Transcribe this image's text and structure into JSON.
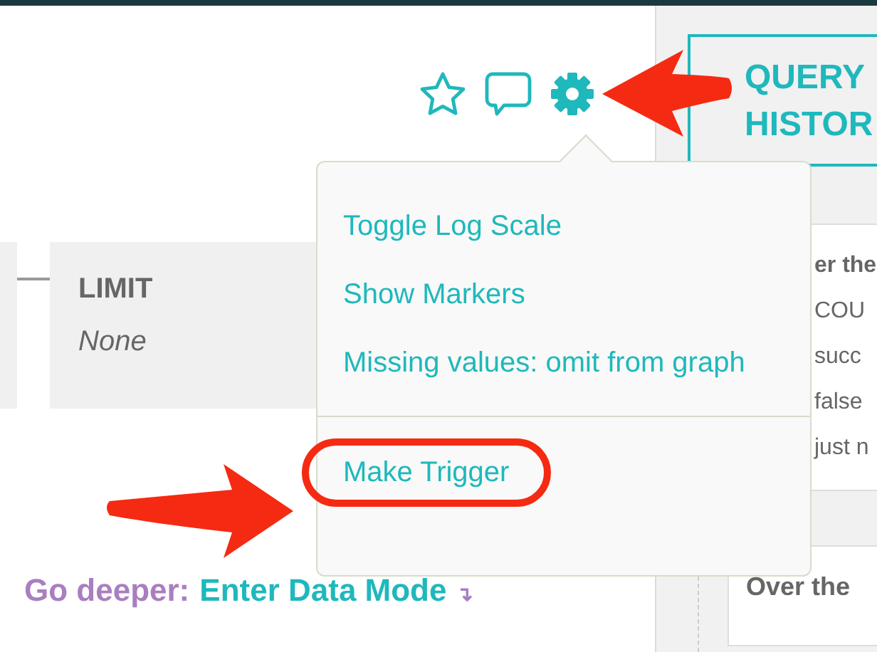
{
  "limit": {
    "label": "LIMIT",
    "value": "None"
  },
  "menu": {
    "sections": [
      [
        {
          "label": "Toggle Log Scale",
          "highlighted": false
        },
        {
          "label": "Show Markers",
          "highlighted": false
        },
        {
          "label": "Missing values: omit from graph",
          "highlighted": false
        }
      ],
      [
        {
          "label": "Make Trigger",
          "highlighted": true
        }
      ]
    ]
  },
  "go_deeper": {
    "prefix": "Go deeper:",
    "link": "Enter Data Mode",
    "symbol": "↴"
  },
  "sidebar": {
    "button_lines": [
      "QUERY",
      "HISTOR"
    ],
    "cards": [
      {
        "lines": [
          "er the",
          "COU",
          "succ",
          "false",
          "just n"
        ]
      },
      {
        "lines": [
          "Over the"
        ]
      }
    ]
  }
}
